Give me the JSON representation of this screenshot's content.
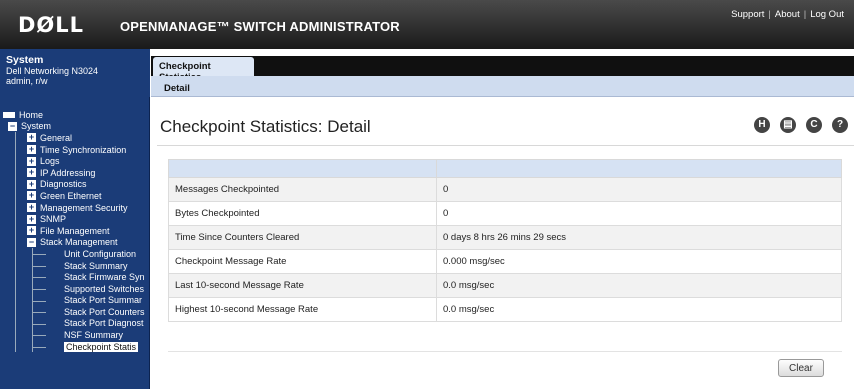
{
  "header": {
    "logo": "DØLL",
    "title": "OPENMANAGE™ SWITCH ADMINISTRATOR",
    "links": [
      "Support",
      "About",
      "Log Out"
    ]
  },
  "system": {
    "title": "System",
    "device": "Dell Networking N3024",
    "user": "admin, r/w"
  },
  "nav": {
    "home": "Home",
    "system": "System",
    "items": [
      "General",
      "Time Synchronization",
      "Logs",
      "IP Addressing",
      "Diagnostics",
      "Green Ethernet",
      "Management Security",
      "SNMP",
      "File Management"
    ],
    "stack": "Stack Management",
    "stack_items": [
      "Unit Configuration",
      "Stack Summary",
      "Stack Firmware Syn",
      "Supported Switches",
      "Stack Port Summar",
      "Stack Port Counters",
      "Stack Port Diagnost",
      "NSF Summary",
      "Checkpoint Statis"
    ]
  },
  "tabs": {
    "main": "Checkpoint Statistics",
    "sub": "Detail"
  },
  "page": {
    "title": "Checkpoint Statistics: Detail",
    "tool_icons": [
      "save-icon",
      "print-icon",
      "refresh-icon",
      "help-icon"
    ]
  },
  "stats": [
    {
      "label": "Messages Checkpointed",
      "value": "0"
    },
    {
      "label": "Bytes Checkpointed",
      "value": "0"
    },
    {
      "label": "Time Since Counters Cleared",
      "value": "0 days 8 hrs 26 mins 29 secs"
    },
    {
      "label": "Checkpoint Message Rate",
      "value": "0.000 msg/sec"
    },
    {
      "label": "Last 10-second Message Rate",
      "value": "0.0 msg/sec"
    },
    {
      "label": "Highest 10-second Message Rate",
      "value": "0.0 msg/sec"
    }
  ],
  "buttons": {
    "clear": "Clear"
  },
  "colors": {
    "nav_bg": "#1b3c78",
    "header_bg": "#1a1a1a",
    "table_header": "#d6e2f3"
  }
}
